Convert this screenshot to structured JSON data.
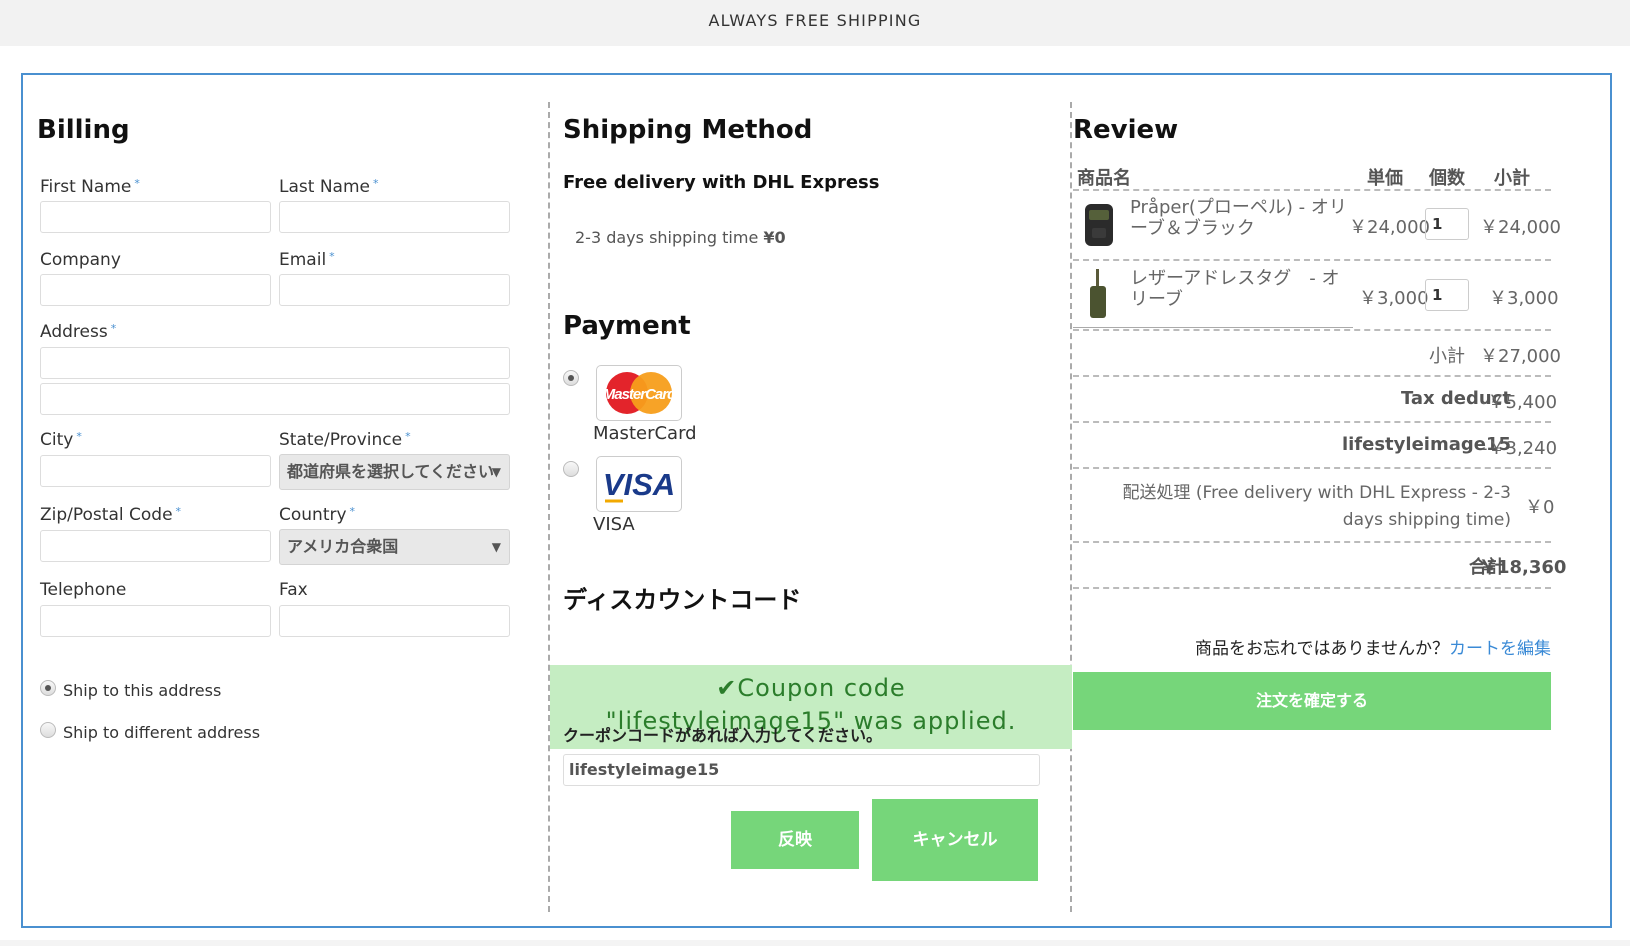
{
  "banner": {
    "text": "ALWAYS FREE SHIPPING"
  },
  "billing": {
    "title": "Billing",
    "first_name": "First Name",
    "last_name": "Last Name",
    "company": "Company",
    "email": "Email",
    "address": "Address",
    "city": "City",
    "state": "State/Province",
    "state_value": "都道府県を選択してください",
    "zip": "Zip/Postal Code",
    "country": "Country",
    "country_value": "アメリカ合衆国",
    "telephone": "Telephone",
    "fax": "Fax",
    "required_mark": "*",
    "ship_same": "Ship to this address",
    "ship_different": "Ship to different address"
  },
  "shipping": {
    "title": "Shipping Method",
    "method": "Free delivery with DHL Express",
    "detail": "2-3 days shipping time",
    "price": "¥0"
  },
  "payment": {
    "title": "Payment",
    "options": [
      {
        "name": "MasterCard",
        "logo_text": "MasterCard",
        "selected": true
      },
      {
        "name": "VISA",
        "logo_text": "VISA",
        "selected": false
      }
    ]
  },
  "discount": {
    "title": "ディスカウントコード",
    "success_message": "Coupon code \"lifestyleimage15\" was applied.",
    "prompt": "クーポンコードがあれば入力してください。",
    "code_value": "lifestyleimage15",
    "apply_label": "反映",
    "cancel_label": "キャンセル"
  },
  "review": {
    "title": "Review",
    "headers": {
      "name": "商品名",
      "unit": "単価",
      "qty": "個数",
      "subtotal": "小計"
    },
    "items": [
      {
        "name_line1": "Pråper(プローペル) - オリ",
        "name_line2": "ーブ＆ブラック",
        "unit": "￥24,000",
        "qty": "1",
        "subtotal": "￥24,000"
      },
      {
        "name_line1": "レザーアドレスタグ　- オ",
        "name_line2": "リーブ",
        "unit": "￥3,000",
        "qty": "1",
        "subtotal": "￥3,000"
      }
    ],
    "subtotal_label": "小計",
    "subtotal_value": "￥27,000",
    "tax_label": "Tax deduct",
    "tax_value": "-￥5,400",
    "coupon_label": "lifestyleimage15",
    "coupon_value": "-￥3,240",
    "shipping_label_line1": "配送処理 (Free delivery with DHL Express - 2-3",
    "shipping_label_line2": "days shipping time)",
    "shipping_value": "￥0",
    "total_label": "合計",
    "total_value": "￥18,360",
    "forgot_text": "商品をお忘れではありませんか？",
    "edit_cart_link": "カートを編集",
    "confirm_label": "注文を確定する"
  }
}
